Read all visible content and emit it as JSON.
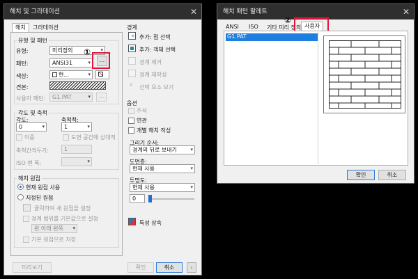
{
  "hatch_dialog": {
    "title": "해치 및 그라데이션",
    "tabs": [
      "해치",
      "그라데이션"
    ],
    "type_pattern": {
      "group": "유형 및 패턴",
      "type_label": "유형:",
      "type_value": "미리정의",
      "pattern_label": "패턴:",
      "pattern_value": "ANSI31",
      "browse": "...",
      "color_label": "색상:",
      "color_value": "현...",
      "swatch_label": "견본:",
      "custom_label": "사용자 패턴:",
      "custom_value": "G1.PAT"
    },
    "angle_scale": {
      "group": "각도 및 축척",
      "angle_label": "각도:",
      "angle_value": "0",
      "scale_label": "축척척:",
      "scale_value": "1",
      "double_label": "이중",
      "paper_label": "도면 공간에 상대적",
      "spacing_label": "축척간격두기:",
      "spacing_value": "1",
      "iso_label": "ISO 펜 폭:"
    },
    "origin": {
      "group": "해치 원점",
      "current": "현재 원점 사용",
      "specified": "지정된 원점",
      "click_set": "클릭하여 새 원점을 설정",
      "boundary_default": "경계 범위를 기본값으로 설정",
      "position_value": "왼 아래 왼쪽",
      "store_default": "기본 원점으로 저장"
    },
    "boundaries": {
      "group": "경계",
      "pick_points": "추가: 점 선택",
      "select_objects": "추가: 객체 선택",
      "remove": "경계 제거",
      "recreate": "경계 재작성",
      "view_selections": "선택 요소 보기"
    },
    "options": {
      "group": "옵션",
      "annotative": "주석",
      "associative": "연관",
      "separate": "개별 해치 작성",
      "draw_order_label": "그리기 순서:",
      "draw_order_value": "경계의 뒤로 보내기",
      "layer_label": "도면층:",
      "layer_value": "현재 사용",
      "transparency_label": "투명도:",
      "transparency_value": "현재 사용",
      "transparency_num": "0"
    },
    "inherit": "특성 상속",
    "preview": "미리보기",
    "ok": "확인",
    "cancel": "취소",
    "help": "도움말",
    "callout1": "①"
  },
  "palette_dialog": {
    "title": "해치 패턴 팔레트",
    "tabs": [
      "ANSI",
      "ISO",
      "기타 미리 정의",
      "사용자"
    ],
    "list_item": "G1.PAT",
    "ok": "확인",
    "cancel": "취소",
    "callout2": "②"
  }
}
